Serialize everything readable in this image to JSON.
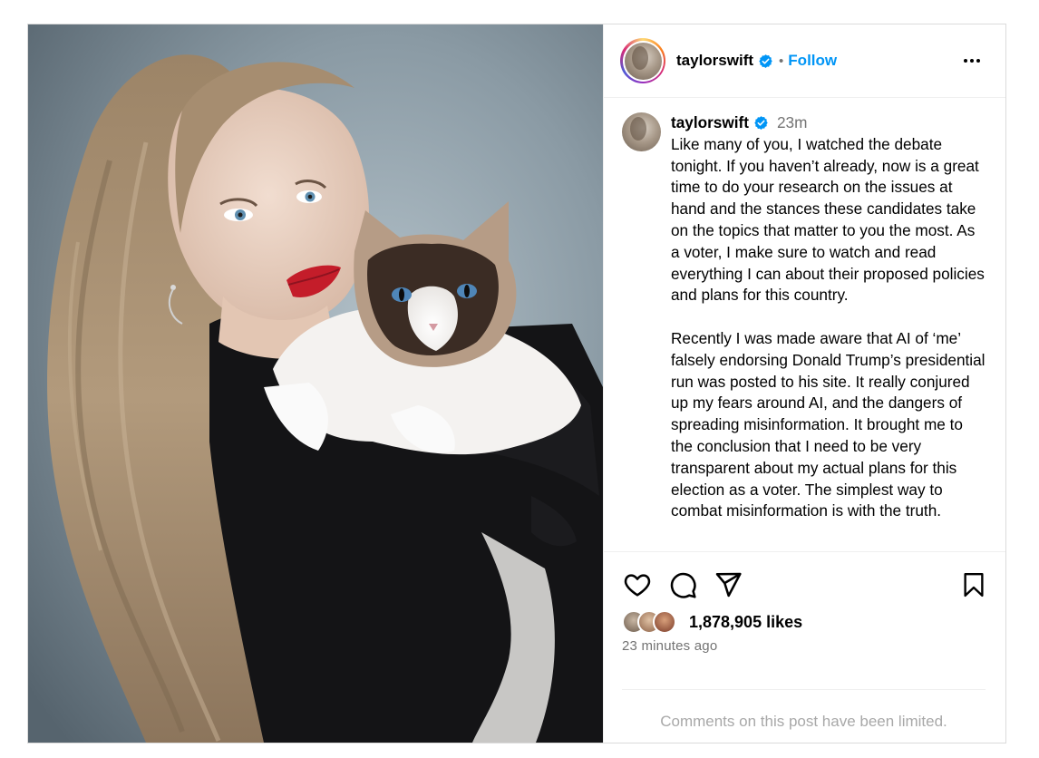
{
  "post": {
    "username": "taylorswift",
    "follow_label": "Follow",
    "separator": "•",
    "caption": {
      "username": "taylorswift",
      "time": "23m",
      "paragraphs": [
        "Like many of you, I watched the debate tonight. If you haven’t already, now is a great time to do your research on the issues at hand and the stances these candidates take on the topics that matter to you the most. As a voter, I make sure to watch and read everything I can about their proposed policies and plans for this country.",
        "Recently I was made aware that AI of ‘me’ falsely endorsing Donald Trump’s presidential run was posted to his site. It really conjured up my fears around AI, and the dangers of spreading misinformation. It brought me to the conclusion that I need to be very transparent about my actual plans for this election as a voter. The simplest way to combat misinformation is with the truth."
      ]
    },
    "likes": "1,878,905 likes",
    "posted_ago": "23 minutes ago",
    "comments_notice": "Comments on this post have been limited."
  },
  "icons": {
    "verified": "verified-badge-icon",
    "like": "heart-icon",
    "comment": "comment-bubble-icon",
    "share": "paper-plane-icon",
    "save": "bookmark-icon",
    "more": "more-horizontal-icon"
  },
  "colors": {
    "accent_blue": "#0095f6",
    "verified_blue": "#0095f6",
    "muted_text": "#737373",
    "faint_text": "#a8a8a8",
    "border": "#dbdbdb"
  }
}
